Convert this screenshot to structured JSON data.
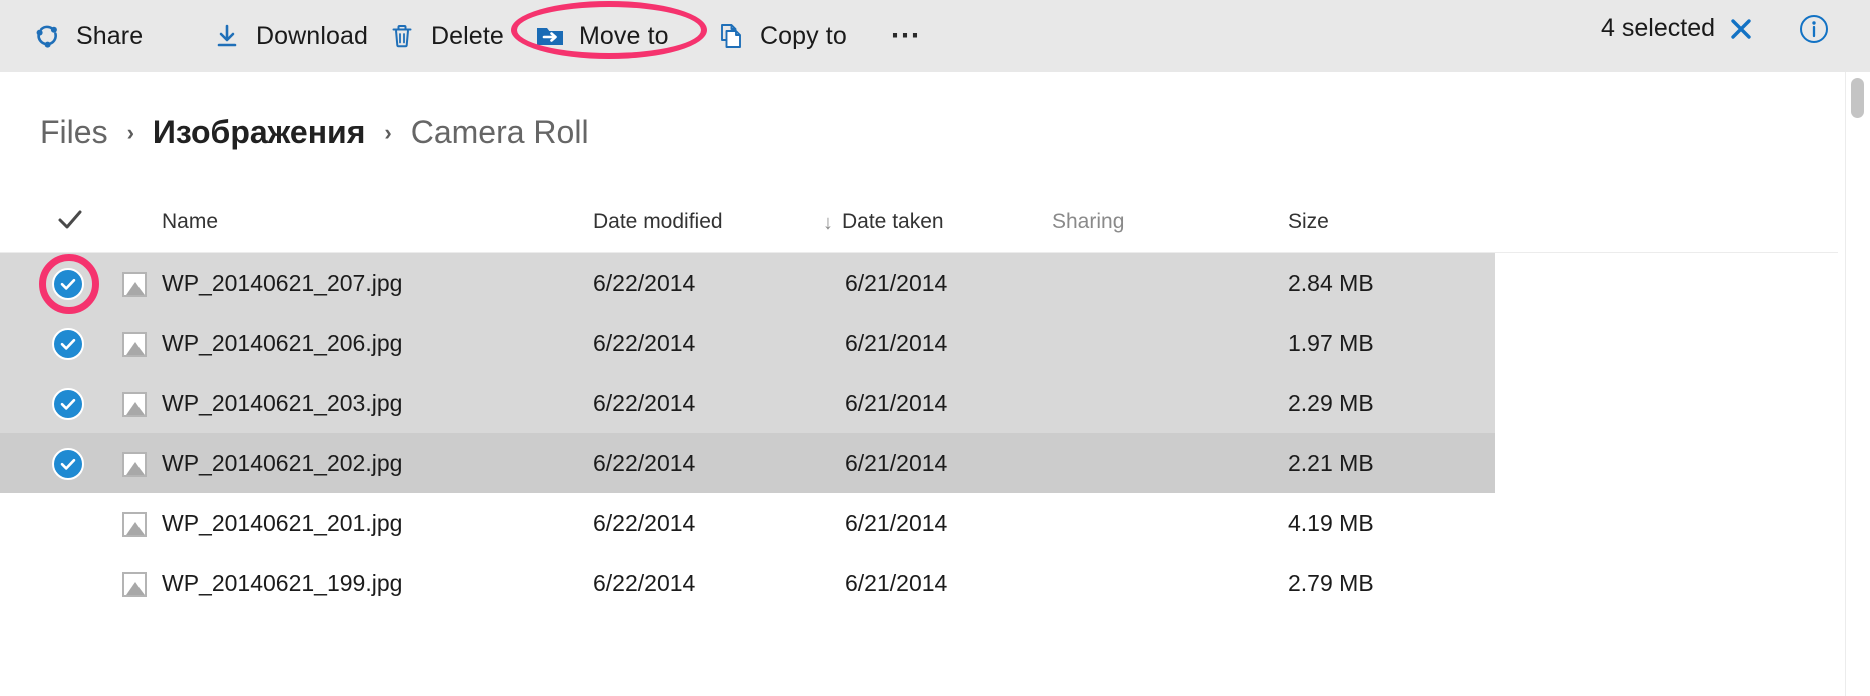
{
  "toolbar": {
    "commands": [
      {
        "label": "Share",
        "icon": "share-icon"
      },
      {
        "label": "Download",
        "icon": "download-icon"
      },
      {
        "label": "Delete",
        "icon": "trash-icon"
      },
      {
        "label": "Move to",
        "icon": "move-to-folder-icon"
      },
      {
        "label": "Copy to",
        "icon": "copy-document-icon"
      }
    ],
    "overflow_icon": "ellipsis-icon",
    "selected_text": "4 selected",
    "clear_icon": "close-x-icon",
    "info_icon": "info-circle-icon"
  },
  "breadcrumb": {
    "separator": "›",
    "items": [
      {
        "label": "Files",
        "current": false
      },
      {
        "label": "Изображения",
        "current": true
      },
      {
        "label": "Camera Roll",
        "current": false
      }
    ]
  },
  "table": {
    "select_all_icon": "checkmark-icon",
    "columns": {
      "name": "Name",
      "date_modified": "Date modified",
      "date_taken": "Date taken",
      "sharing": "Sharing",
      "size": "Size"
    },
    "sort": {
      "column": "date_taken",
      "arrow": "↓"
    },
    "rows": [
      {
        "name": "WP_20140621_207.jpg",
        "date_modified": "6/22/2014",
        "date_taken": "6/21/2014",
        "sharing": "",
        "size": "2.84 MB",
        "selected": true,
        "hover": false,
        "icon": "image-file-icon"
      },
      {
        "name": "WP_20140621_206.jpg",
        "date_modified": "6/22/2014",
        "date_taken": "6/21/2014",
        "sharing": "",
        "size": "1.97 MB",
        "selected": true,
        "hover": false,
        "icon": "image-file-icon"
      },
      {
        "name": "WP_20140621_203.jpg",
        "date_modified": "6/22/2014",
        "date_taken": "6/21/2014",
        "sharing": "",
        "size": "2.29 MB",
        "selected": true,
        "hover": false,
        "icon": "image-file-icon"
      },
      {
        "name": "WP_20140621_202.jpg",
        "date_modified": "6/22/2014",
        "date_taken": "6/21/2014",
        "sharing": "",
        "size": "2.21 MB",
        "selected": true,
        "hover": true,
        "icon": "image-file-icon"
      },
      {
        "name": "WP_20140621_201.jpg",
        "date_modified": "6/22/2014",
        "date_taken": "6/21/2014",
        "sharing": "",
        "size": "4.19 MB",
        "selected": false,
        "hover": false,
        "icon": "image-file-icon"
      },
      {
        "name": "WP_20140621_199.jpg",
        "date_modified": "6/22/2014",
        "date_taken": "6/21/2014",
        "sharing": "",
        "size": "2.79 MB",
        "selected": false,
        "hover": false,
        "icon": "image-file-icon"
      }
    ]
  },
  "annotations": [
    {
      "target": "Move to",
      "shape": "ellipse",
      "color": "#f5336e"
    },
    {
      "target": "row-checkbox-WP_20140621_207.jpg",
      "shape": "circle",
      "color": "#f5336e"
    }
  ],
  "colors": {
    "accent": "#1f8ad2",
    "toolbar_bg": "#e8e8e8",
    "selected_row": "#d8d8d8",
    "hover_row": "#cccccc",
    "annotation": "#f5336e"
  }
}
